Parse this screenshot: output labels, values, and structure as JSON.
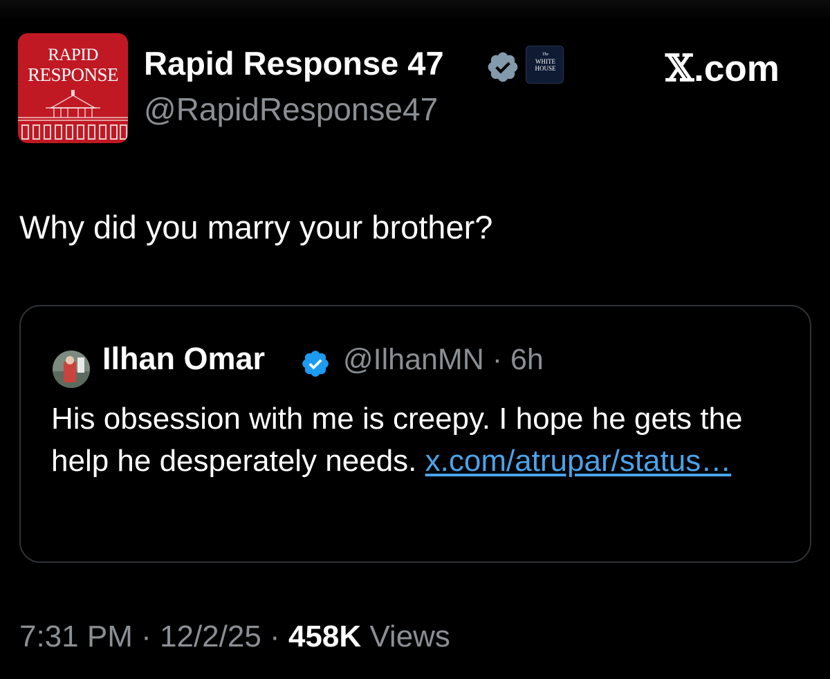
{
  "header": {
    "avatar": {
      "logo_line1": "RAPID",
      "logo_line2": "RESPONSE",
      "background": "#c01923"
    },
    "display_name": "Rapid Response 47",
    "handle": "@RapidResponse47",
    "verified_icon": "gray-verified-badge-icon",
    "affiliation_badge": {
      "line0": "The",
      "line1": "WHITE",
      "line2": "HOUSE"
    },
    "source_label_x": "𝕏",
    "source_label_rest": ".com"
  },
  "tweet": {
    "text": "Why did you marry your brother?"
  },
  "quoted_tweet": {
    "name": "Ilhan Omar",
    "verified_icon": "blue-verified-badge-icon",
    "handle": "@IlhanMN",
    "separator": "·",
    "time": "6h",
    "text": "His obsession with me is creepy. I hope he gets the help he desperately needs. ",
    "link_text": "x.com/atrupar/status…",
    "link_color": "#4aa3ea"
  },
  "footer": {
    "time": "7:31 PM",
    "date": "12/2/25",
    "separator": "·",
    "views_count": "458K",
    "views_label": "Views"
  },
  "colors": {
    "background": "#000000",
    "primary_text": "#ffffff",
    "secondary_text": "#8b8f94",
    "border": "#2f3336",
    "verified_blue": "#1d9bf0",
    "verified_gray": "#829aab"
  }
}
